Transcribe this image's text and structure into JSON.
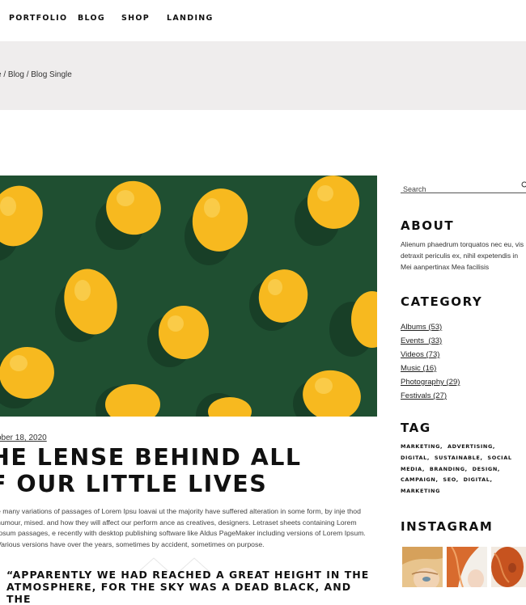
{
  "nav": {
    "items": [
      "Portfolio",
      "Blog",
      "Shop",
      "Landing"
    ]
  },
  "breadcrumb": {
    "text": "e / Blog / Blog Single"
  },
  "post": {
    "date": "ober 18, 2020",
    "title_line1": "HE LENSE BEHIND ALL",
    "title_line2": "F OUR LITTLE LIVES",
    "body": "e many variations of passages of Lorem Ipsu loavai ut the majority have suffered alteration in some form, by inje thod humour, mised. and how they will affect our perform ance as creatives, designers. Letraset sheets containing Lorem Ipsum passages, e recently with desktop publishing software like Aldus PageMaker including versions of Lorem Ipsum. Various versions have over the years, sometimes by accident, sometimes on purpose.",
    "quote": "“Apparently we had reached a great height in the atmosphere, for the sky was a dead black, and the"
  },
  "sidebar": {
    "search_placeholder": "Search",
    "about_title": "About",
    "about_text": "Alienum phaedrum torquatos nec eu, vis detraxit periculis ex, nihil expetendis in Mei aanpertinax Mea facilisis",
    "category_title": "Category",
    "categories": [
      "Albums (53)",
      "Events  (33)",
      "Videos (73)",
      "Music (16)",
      "Photography (29)",
      "Festivals (27)"
    ],
    "tag_title": "Tag",
    "tags": [
      "Marketing,",
      "Advertising,",
      "Digital,",
      "Sustainable,",
      "Social",
      "Media,",
      "Branding,",
      "Design,",
      "Campaign,",
      "SEO,",
      "Digital,",
      "Marketing"
    ],
    "instagram_title": "Instagram"
  },
  "colors": {
    "hero_background": "#1f4f31",
    "lemon": "#f7b91f",
    "breadcrumb_band": "#efeded"
  }
}
